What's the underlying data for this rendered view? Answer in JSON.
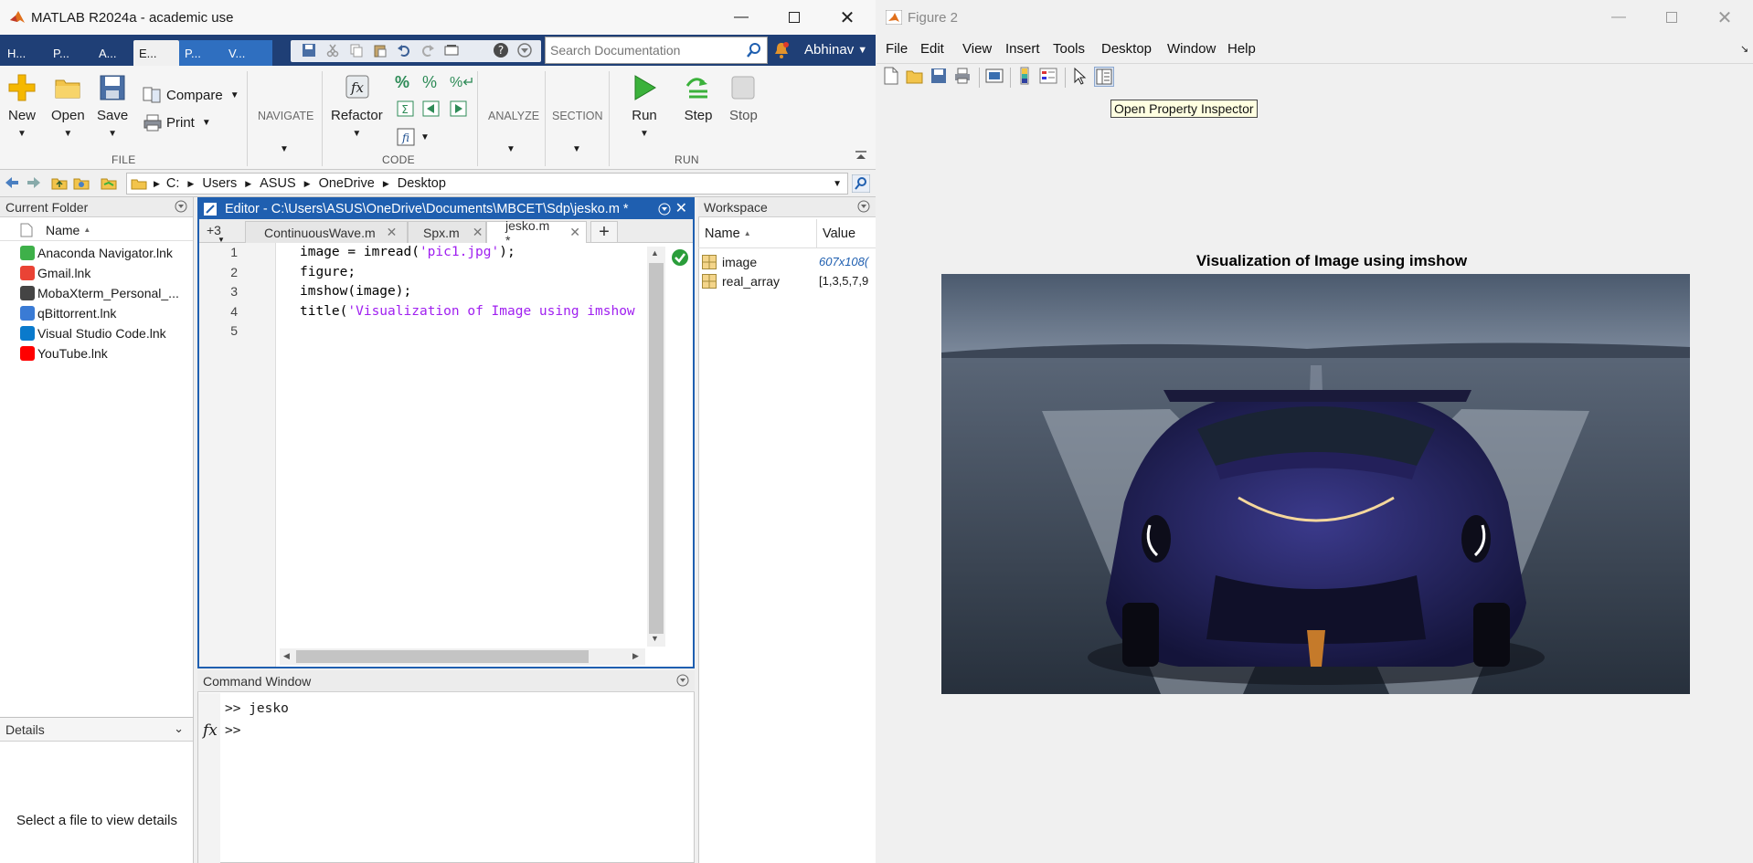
{
  "matlab": {
    "title": "MATLAB R2024a - academic use",
    "tabs": [
      {
        "label": "H..."
      },
      {
        "label": "P..."
      },
      {
        "label": "A..."
      },
      {
        "label": "E..."
      },
      {
        "label": "P..."
      },
      {
        "label": "V..."
      }
    ],
    "search_placeholder": "Search Documentation",
    "user": "Abhinav",
    "ribbon": {
      "new": "New",
      "open": "Open",
      "save": "Save",
      "compare": "Compare",
      "print": "Print",
      "file_section": "FILE",
      "navigate": "NAVIGATE",
      "refactor": "Refactor",
      "code_section": "CODE",
      "analyze": "ANALYZE",
      "section": "SECTION",
      "run": "Run",
      "step": "Step",
      "stop": "Stop",
      "run_section": "RUN"
    },
    "path": [
      "C:",
      "Users",
      "ASUS",
      "OneDrive",
      "Desktop"
    ],
    "current_folder": {
      "title": "Current Folder",
      "column": "Name",
      "files": [
        {
          "name": "Anaconda Navigator.lnk",
          "icon": "anaconda-icon",
          "color": "#3eb049"
        },
        {
          "name": "Gmail.lnk",
          "icon": "gmail-icon",
          "color": "#ea4335"
        },
        {
          "name": "MobaXterm_Personal_...",
          "icon": "mobaxterm-icon",
          "color": "#444444"
        },
        {
          "name": "qBittorrent.lnk",
          "icon": "qbittorrent-icon",
          "color": "#3a7bd5"
        },
        {
          "name": "Visual Studio Code.lnk",
          "icon": "vscode-icon",
          "color": "#0a7acc"
        },
        {
          "name": "YouTube.lnk",
          "icon": "youtube-icon",
          "color": "#ff0000"
        }
      ]
    },
    "details": {
      "title": "Details",
      "empty_text": "Select a file to view details"
    },
    "editor": {
      "title": "Editor - C:\\Users\\ASUS\\OneDrive\\Documents\\MBCET\\Sdp\\jesko.m *",
      "more_tabs": "+3",
      "tabs": [
        "ContinuousWave.m",
        "Spx.m",
        "jesko.m *"
      ],
      "lines": [
        {
          "n": "1",
          "code": "image = imread(",
          "str": "'pic1.jpg'",
          "end": ");"
        },
        {
          "n": "2",
          "code": "figure;",
          "str": "",
          "end": ""
        },
        {
          "n": "3",
          "code": "imshow(image);",
          "str": "",
          "end": ""
        },
        {
          "n": "4",
          "code": "title(",
          "str": "'Visualization of Image using imshow",
          "end": ""
        },
        {
          "n": "5",
          "code": "",
          "str": "",
          "end": ""
        }
      ]
    },
    "command_window": {
      "title": "Command Window",
      "lines": [
        ">> jesko",
        ">>"
      ],
      "fx": "fx"
    },
    "workspace": {
      "title": "Workspace",
      "columns": [
        "Name",
        "Value"
      ],
      "vars": [
        {
          "name": "image",
          "value": "607x108("
        },
        {
          "name": "real_array",
          "value": "[1,3,5,7,9"
        }
      ]
    }
  },
  "figure": {
    "title": "Figure 2",
    "menus": [
      "File",
      "Edit",
      "View",
      "Insert",
      "Tools",
      "Desktop",
      "Window",
      "Help"
    ],
    "tooltip": "Open Property Inspector",
    "plot_title": "Visualization of Image using imshow"
  }
}
